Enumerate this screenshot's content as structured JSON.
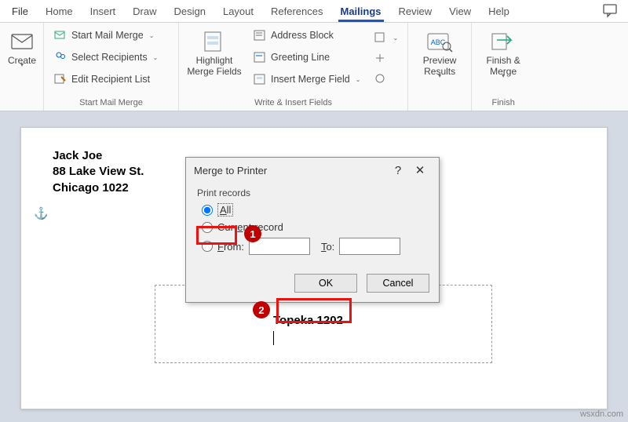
{
  "tabs": {
    "file": "File",
    "items": [
      "Home",
      "Insert",
      "Draw",
      "Design",
      "Layout",
      "References",
      "Mailings",
      "Review",
      "View",
      "Help"
    ],
    "active_index": 6
  },
  "ribbon": {
    "create": {
      "label": "Create"
    },
    "start_group": {
      "label": "Start Mail Merge",
      "start": "Start Mail Merge",
      "select": "Select Recipients",
      "edit": "Edit Recipient List"
    },
    "highlight": {
      "label": "Highlight\nMerge Fields"
    },
    "write_group": {
      "label": "Write & Insert Fields",
      "address": "Address Block",
      "greeting": "Greeting Line",
      "insert": "Insert Merge Field"
    },
    "preview": {
      "label": "Preview\nResults"
    },
    "finish": {
      "label": "Finish &\nMerge",
      "group_label": "Finish"
    }
  },
  "document": {
    "addr_line1": "Jack Joe",
    "addr_line2": "88 Lake View St.",
    "addr_line3": "Chicago 1022",
    "label_text": "Topeka 1202"
  },
  "dialog": {
    "title": "Merge to Printer",
    "section": "Print records",
    "opt_all": "All",
    "opt_current": "Current record",
    "opt_from": "From:",
    "to_label": "To:",
    "ok": "OK",
    "cancel": "Cancel",
    "selected": "all"
  },
  "annotations": {
    "badge1": "1",
    "badge2": "2"
  },
  "watermark": "wsxdn.com"
}
